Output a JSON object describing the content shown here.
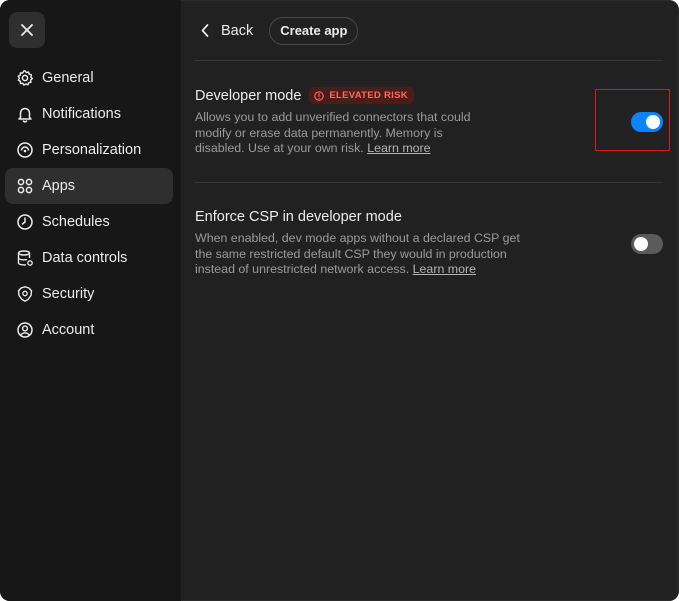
{
  "sidebar": {
    "close_icon": "x-icon",
    "items": [
      {
        "label": "General",
        "icon": "gear-icon",
        "active": false
      },
      {
        "label": "Notifications",
        "icon": "bell-icon",
        "active": false
      },
      {
        "label": "Personalization",
        "icon": "personalization-icon",
        "active": false
      },
      {
        "label": "Apps",
        "icon": "apps-grid-icon",
        "active": true
      },
      {
        "label": "Schedules",
        "icon": "clock-icon",
        "active": false
      },
      {
        "label": "Data controls",
        "icon": "database-icon",
        "active": false
      },
      {
        "label": "Security",
        "icon": "shield-icon",
        "active": false
      },
      {
        "label": "Account",
        "icon": "user-circle-icon",
        "active": false
      }
    ]
  },
  "header": {
    "back_label": "Back",
    "create_app_label": "Create app"
  },
  "settings": {
    "developer_mode": {
      "title": "Developer mode",
      "badge": "ELEVATED RISK",
      "description": "Allows you to add unverified connectors that could modify or erase data permanently. Memory is disabled. Use at your own risk.",
      "learn_more": "Learn more",
      "enabled": true
    },
    "enforce_csp": {
      "title": "Enforce CSP in developer mode",
      "description": "When enabled, dev mode apps without a declared CSP get the same restricted default CSP they would in production instead of unrestricted network access.",
      "learn_more": "Learn more",
      "enabled": false
    }
  },
  "colors": {
    "accent": "#0a84ff",
    "badge_text": "#ff6b5e",
    "badge_bg": "#4a1d1b",
    "highlight": "#e0161d"
  }
}
